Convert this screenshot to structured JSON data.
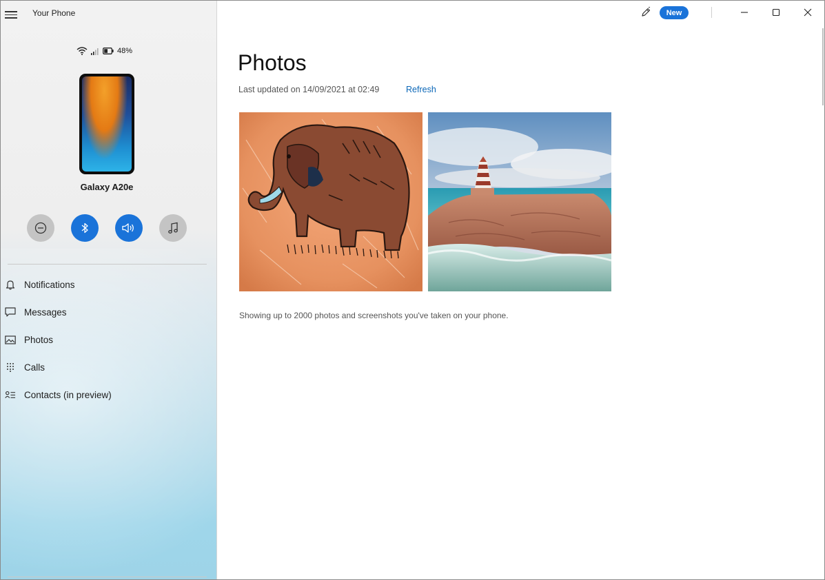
{
  "window": {
    "app_title": "Your Phone",
    "new_badge": "New"
  },
  "sidebar": {
    "status": {
      "battery": "48%"
    },
    "device_name": "Galaxy A20e",
    "quick_actions": [
      {
        "icon": "do-not-disturb-icon",
        "state": "off"
      },
      {
        "icon": "bluetooth-icon",
        "state": "on"
      },
      {
        "icon": "volume-icon",
        "state": "on"
      },
      {
        "icon": "music-note-icon",
        "state": "off"
      }
    ],
    "nav": [
      {
        "label": "Notifications",
        "icon": "bell-icon"
      },
      {
        "label": "Messages",
        "icon": "message-icon"
      },
      {
        "label": "Photos",
        "icon": "photos-icon"
      },
      {
        "label": "Calls",
        "icon": "dialpad-icon"
      },
      {
        "label": "Contacts (in preview)",
        "icon": "contacts-icon"
      }
    ]
  },
  "main": {
    "title": "Photos",
    "last_updated": "Last updated on 14/09/2021 at 02:49",
    "refresh_label": "Refresh",
    "footnote": "Showing up to 2000 photos and screenshots you've taken on your phone."
  },
  "colors": {
    "accent": "#1a73d9",
    "link": "#0b67b8"
  }
}
